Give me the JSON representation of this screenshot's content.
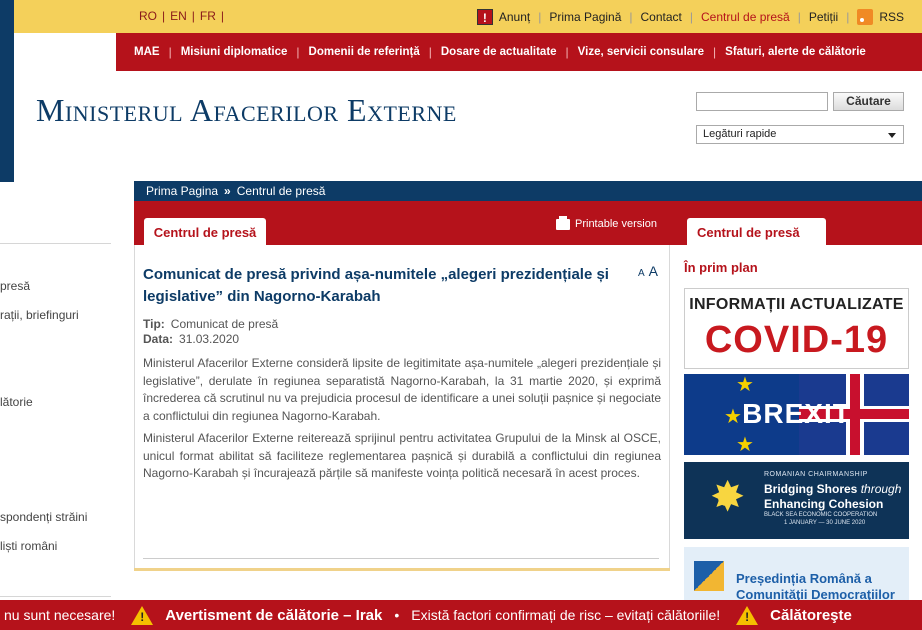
{
  "colors": {
    "brand_red": "#b5121b",
    "brand_blue": "#0d3b66",
    "top_yellow": "#f4d05a"
  },
  "languages": [
    "RO",
    "EN",
    "FR"
  ],
  "top_links": {
    "anunt": "Anunț",
    "prima_pagina": "Prima Pagină",
    "contact": "Contact",
    "centrul_de_presa": "Centrul de presă",
    "petitii": "Petiții",
    "rss": "RSS"
  },
  "main_nav": [
    "MAE",
    "Misiuni diplomatice",
    "Domenii de referință",
    "Dosare de actualitate",
    "Vize, servicii consulare",
    "Sfaturi, alerte de călătorie"
  ],
  "logo": "Ministerul Afacerilor Externe",
  "search": {
    "placeholder": "",
    "button": "Căutare"
  },
  "quick_links": "Legături rapide",
  "sidebar": {
    "items": [
      "presă",
      "rații, briefinguri",
      "lătorie",
      "spondenți străini",
      "liști români"
    ]
  },
  "breadcrumb": {
    "home": "Prima Pagina",
    "current": "Centrul de presă"
  },
  "tabs": {
    "main": "Centrul de presă",
    "side": "Centrul de presă"
  },
  "printable": "Printable version",
  "article": {
    "title": "Comunicat de presă privind așa-numitele „alegeri prezidențiale și legislative” din Nagorno-Karabah",
    "font_small": "A",
    "font_big": "A",
    "tip_label": "Tip:",
    "tip_value": "Comunicat de presă",
    "data_label": "Data:",
    "data_value": "31.03.2020",
    "paragraphs": [
      "Ministerul Afacerilor Externe consideră lipsite de legitimitate așa-numitele „alegeri prezidențiale și legislative”, derulate în regiunea separatistă Nagorno-Karabah, la 31 martie 2020, și exprimă încrederea că scrutinul nu va prejudicia procesul de identificare a unei soluții pașnice și negociate a conflictului din regiunea Nagorno-Karabah.",
      "Ministerul Afacerilor Externe reiterează sprijinul pentru activitatea Grupului de la Minsk al OSCE, unicul format abilitat să faciliteze reglementarea pașnică și durabilă a conflictului din regiunea Nagorno-Karabah și încurajează părțile să manifeste voința politică necesară în acest proces."
    ]
  },
  "right": {
    "heading": "În prim plan",
    "covid_line1": "INFORMAȚII ACTUALIZATE",
    "covid_line2": "COVID-19",
    "brexit": "BREXIT",
    "charm_kicker": "ROMANIAN CHAIRMANSHIP",
    "charm_h1a": "Bridging Shores",
    "charm_h1b": "through",
    "charm_h2": "Enhancing Cohesion",
    "charm_small": "BLACK SEA ECONOMIC COOPERATION",
    "charm_dates": "1 JANUARY — 30 JUNE 2020",
    "pres_t1": "Președinția Română a",
    "pres_t2": "Comunităţii Democraţiilor"
  },
  "ticker": {
    "lead": "nu sunt necesare!",
    "alert1": "Avertisment de călătorie – Irak",
    "bullet": "•",
    "alert1_text": "Există factori confirmați de risc – evitați călătoriile!",
    "alert2": "Călătoreşte"
  }
}
